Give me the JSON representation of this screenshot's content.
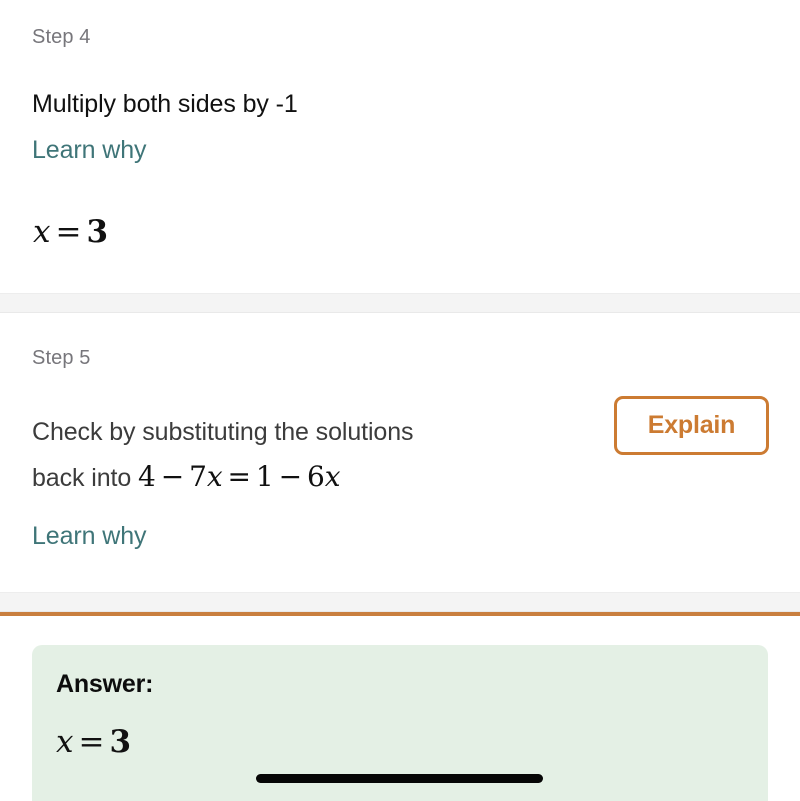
{
  "steps": [
    {
      "label": "Step 4",
      "title": "Multiply both sides by -1",
      "learn_why": "Learn why",
      "equation": {
        "lhs_var": "x",
        "operator": "=",
        "rhs": "3"
      }
    },
    {
      "label": "Step 5",
      "title_line1": "Check by substituting the solutions",
      "title_line2_prefix": "back into ",
      "equation_inline": {
        "t1": "4",
        "op1": "−",
        "t2": "7",
        "v2": "x",
        "op2": "=",
        "t3": "1",
        "op3": "−",
        "t4": "6",
        "v4": "x"
      },
      "learn_why": "Learn why",
      "explain_button": "Explain"
    }
  ],
  "answer": {
    "label": "Answer:",
    "equation": {
      "lhs_var": "x",
      "operator": "=",
      "rhs": "3"
    }
  },
  "colors": {
    "teal_link": "#3f7578",
    "orange_accent": "#cc7b32",
    "answer_bg": "#e4f0e5",
    "step_label_gray": "#77767b",
    "divider_gray": "#f4f4f4"
  }
}
